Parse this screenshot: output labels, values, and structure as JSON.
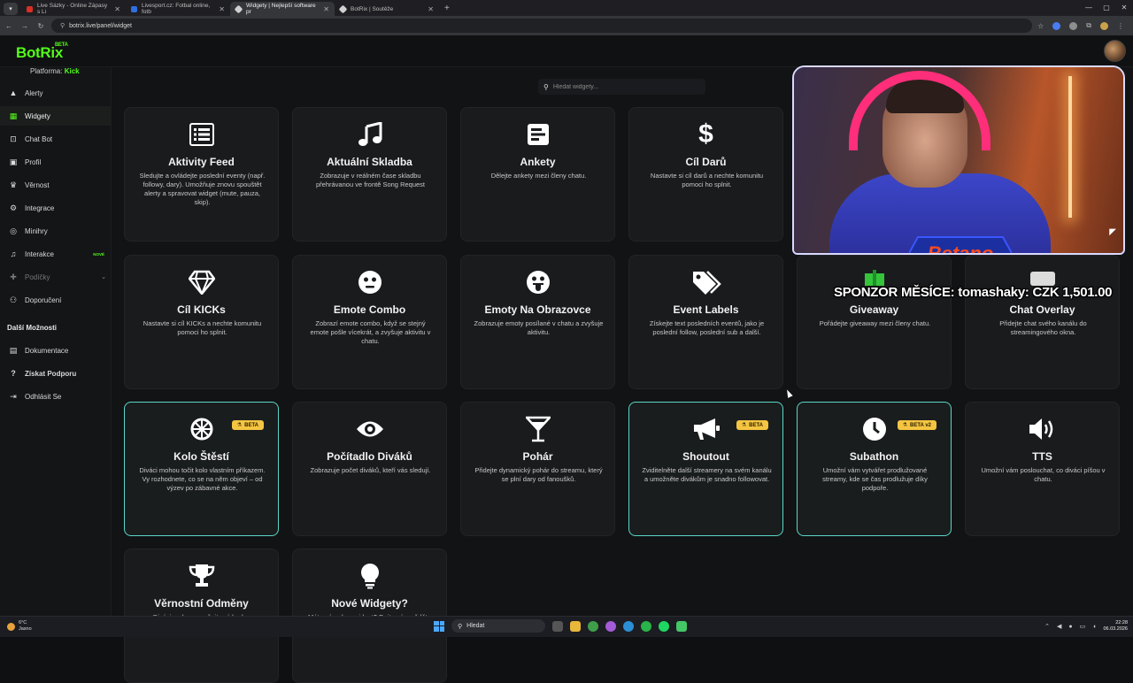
{
  "browser": {
    "tabs": [
      {
        "label": "Live Sázky - Online Zápasy s Li",
        "color": "#d93025",
        "active": false
      },
      {
        "label": "Livesport.cz: Fotbal online, fotb",
        "color": "#2f6fe0",
        "active": false
      },
      {
        "label": "Widgety | Nejlepší software pr",
        "color": "#d0d0d0",
        "active": true
      },
      {
        "label": "BotRix | Soutěže",
        "color": "#d0d0d0",
        "active": false
      }
    ],
    "url": "botrix.live/panel/widget"
  },
  "app": {
    "logo": "BotRix",
    "logo_badge": "BETA",
    "platform_label": "Platforma:",
    "platform_value": "Kick"
  },
  "sidebar": {
    "items": [
      {
        "label": "Alerty",
        "icon": "warning-icon"
      },
      {
        "label": "Widgety",
        "icon": "grid-icon",
        "active": true
      },
      {
        "label": "Chat Bot",
        "icon": "robot-icon"
      },
      {
        "label": "Profil",
        "icon": "profile-icon"
      },
      {
        "label": "Věrnost",
        "icon": "trophy-icon"
      },
      {
        "label": "Integrace",
        "icon": "integration-icon"
      },
      {
        "label": "Minihry",
        "icon": "gamepad-icon"
      },
      {
        "label": "Interakce",
        "icon": "music-icon",
        "badge": "NOVÉ"
      },
      {
        "label": "Podíčky",
        "icon": "gift-icon",
        "dim": true
      },
      {
        "label": "Doporučení",
        "icon": "users-icon"
      }
    ],
    "section_title": "Další Možnosti",
    "more_items": [
      {
        "label": "Dokumentace",
        "icon": "book-icon"
      },
      {
        "label": "Získat Podporu",
        "icon": "help-icon"
      },
      {
        "label": "Odhlásit Se",
        "icon": "logout-icon"
      }
    ]
  },
  "search": {
    "placeholder": "Hledat widgety..."
  },
  "widgets": [
    {
      "title": "Aktivity Feed",
      "desc": "Sledujte a ovládejte poslední eventy (např. followy, dary). Umožňuje znovu spouštět alerty a spravovat widget (mute, pauza, skip).",
      "icon": "list-icon"
    },
    {
      "title": "Aktuální Skladba",
      "desc": "Zobrazuje v reálném čase skladbu přehrávanou ve frontě Song Request",
      "icon": "music-note-icon"
    },
    {
      "title": "Ankety",
      "desc": "Dělejte ankety mezi členy chatu.",
      "icon": "poll-icon"
    },
    {
      "title": "Cíl Darů",
      "desc": "Nastavte si cíl darů a nechte komunitu pomoci ho splnit.",
      "icon": "dollar-icon"
    },
    {
      "title": "Cíl KICKs",
      "desc": "Nastavte si cíl KICKs a nechte komunitu pomoci ho splnit.",
      "icon": "diamond-icon"
    },
    {
      "title": "Emote Combo",
      "desc": "Zobrazí emote combo, když se stejný emote pošle vícekrát, a zvyšuje aktivitu v chatu.",
      "icon": "face-icon"
    },
    {
      "title": "Emoty Na Obrazovce",
      "desc": "Zobrazuje emoty posílané v chatu a zvyšuje aktivitu.",
      "icon": "tongue-face-icon"
    },
    {
      "title": "Event Labels",
      "desc": "Získejte text posledních eventů, jako je poslední follow, poslední sub a další.",
      "icon": "tags-icon"
    },
    {
      "title": "Giveaway",
      "desc": "Pořádejte giveaway mezi členy chatu.",
      "icon": "gift-icon"
    },
    {
      "title": "Chat Overlay",
      "desc": "Přidejte chat svého kanálu do streamingového okna.",
      "icon": "chat-icon"
    },
    {
      "title": "Kolo Štěstí",
      "desc": "Diváci mohou točit kolo vlastním příkazem. Vy rozhodnete, co se na něm objeví – od výzev po zábavné akce.",
      "icon": "wheel-icon",
      "badge": "BETA",
      "highlight": true
    },
    {
      "title": "Počítadlo Diváků",
      "desc": "Zobrazuje počet diváků, kteří vás sledují.",
      "icon": "eye-icon"
    },
    {
      "title": "Pohár",
      "desc": "Přidejte dynamický pohár do streamu, který se plní dary od fanoušků.",
      "icon": "cocktail-icon"
    },
    {
      "title": "Shoutout",
      "desc": "Zviditelněte další streamery na svém kanálu a umožněte divákům je snadno followovat.",
      "icon": "megaphone-icon",
      "badge": "BETA",
      "highlight": true
    },
    {
      "title": "Subathon",
      "desc": "Umožní vám vytvářet prodlužované streamy, kde se čas prodlužuje díky podpoře.",
      "icon": "clock-icon",
      "badge": "BETA v2",
      "highlight": true
    },
    {
      "title": "TTS",
      "desc": "Umožní vám poslouchat, co diváci píšou v chatu.",
      "icon": "speaker-icon"
    },
    {
      "title": "Věrnostní Odměny",
      "desc": "Diváci mohou vyměnit své body...",
      "icon": "trophy-icon"
    },
    {
      "title": "Nové Widgety?",
      "desc": "Máte nápad na widget? Dejte nám vědět...",
      "icon": "lightbulb-icon"
    }
  ],
  "overlay": {
    "sponsor_text": "SPONZOR MĚSÍCE: tomashaky: CZK 1,501.00",
    "brand": "Betano"
  },
  "taskbar": {
    "temp": "6°C",
    "weather": "Jasno",
    "search": "Hledat",
    "time": "22:28",
    "date": "06.03.2026"
  }
}
